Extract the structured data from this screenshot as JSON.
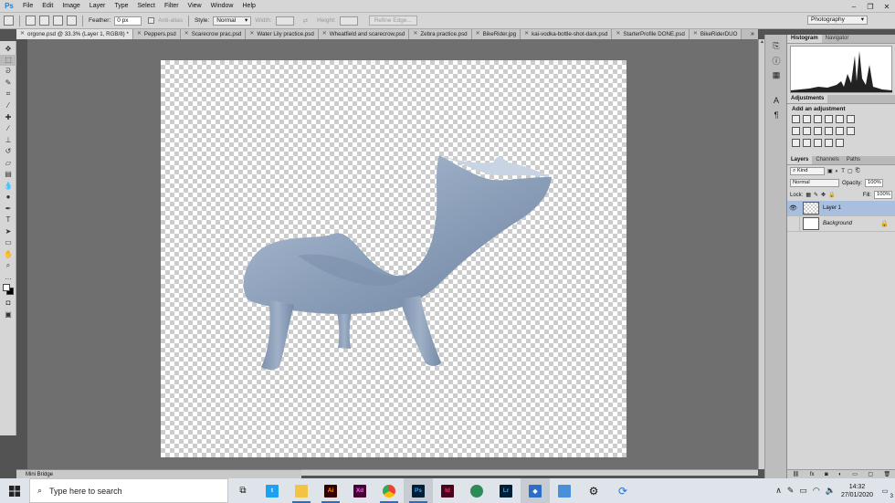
{
  "app": {
    "logo": "Ps",
    "menus": [
      "File",
      "Edit",
      "Image",
      "Layer",
      "Type",
      "Select",
      "Filter",
      "View",
      "Window",
      "Help"
    ]
  },
  "options": {
    "feather_label": "Feather:",
    "feather_value": "0 px",
    "antialias_label": "Anti-alias",
    "style_label": "Style:",
    "style_value": "Normal",
    "width_label": "Width:",
    "height_label": "Height:",
    "refine_label": "Refine Edge...",
    "workspace": "Photography"
  },
  "tabs": [
    {
      "label": "orgone.psd @ 33.3% (Layer 1, RGB/8) *",
      "active": true
    },
    {
      "label": "Peppers.psd"
    },
    {
      "label": "Scarecrow prac.psd"
    },
    {
      "label": "Water Lily practice.psd"
    },
    {
      "label": "Wheatfield and scarecrow.psd"
    },
    {
      "label": "Zebra practice.psd"
    },
    {
      "label": "BikeRider.jpg"
    },
    {
      "label": "kai-vodka-bottle-shot-dark.psd"
    },
    {
      "label": "StarterProfile DONE.psd"
    },
    {
      "label": "BikeRiderDUO"
    }
  ],
  "tab_overflow": "»",
  "minibridge": "Mini Bridge",
  "panels": {
    "top_tabs": [
      "Histogram",
      "Navigator"
    ],
    "adjustments_tab": "Adjustments",
    "adjustments_title": "Add an adjustment",
    "layers_tabs": [
      "Layers",
      "Channels",
      "Paths"
    ],
    "kind_label": "Kind",
    "blend_mode": "Normal",
    "opacity_label": "Opacity:",
    "opacity_value": "100%",
    "lock_label": "Lock:",
    "fill_label": "Fill:",
    "fill_value": "100%",
    "layers": [
      {
        "name": "Layer 1",
        "selected": true,
        "visible": true
      },
      {
        "name": "Background",
        "selected": false,
        "visible": false,
        "locked": true
      }
    ]
  },
  "taskbar": {
    "search_placeholder": "Type here to search",
    "apps": [
      {
        "name": "task-view",
        "label": "",
        "color": "#333"
      },
      {
        "name": "twitter",
        "label": "",
        "color": "#1da1f2"
      },
      {
        "name": "file-explorer",
        "label": "",
        "color": "#f3c343"
      },
      {
        "name": "illustrator",
        "label": "Ai",
        "color": "#ff9a00"
      },
      {
        "name": "xd",
        "label": "Xd",
        "color": "#ff61f6"
      },
      {
        "name": "chrome",
        "label": "",
        "color": "#4285f4"
      },
      {
        "name": "photoshop",
        "label": "Ps",
        "color": "#31a8ff"
      },
      {
        "name": "indesign",
        "label": "Id",
        "color": "#ff3366"
      },
      {
        "name": "maps",
        "label": "",
        "color": "#2e8b57"
      },
      {
        "name": "lightroom",
        "label": "Lr",
        "color": "#31a8ff"
      },
      {
        "name": "security",
        "label": "",
        "color": "#2b6fc4"
      },
      {
        "name": "remote",
        "label": "",
        "color": "#4a90d9"
      },
      {
        "name": "settings",
        "label": "",
        "color": "#333"
      },
      {
        "name": "sync",
        "label": "",
        "color": "#2b6fc4"
      }
    ],
    "time": "14:32",
    "date": "27/01/2020",
    "notifications": "3"
  },
  "colors": {
    "chair": "#8ea1bb",
    "ps_blue": "#31a8ff"
  }
}
